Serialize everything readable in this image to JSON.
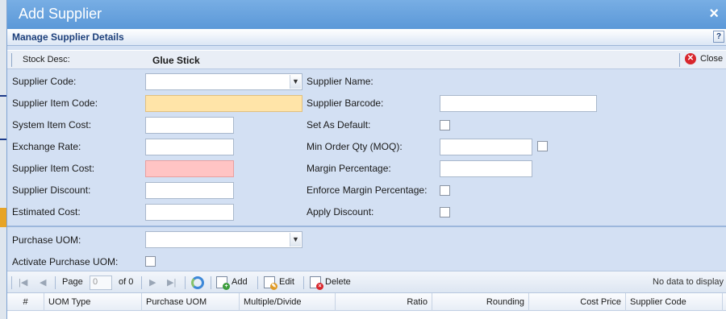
{
  "dialog": {
    "title": "Add Supplier",
    "close_icon": "×"
  },
  "panel": {
    "title": "Manage Supplier Details",
    "help": "?"
  },
  "stock": {
    "label": "Stock Desc:",
    "value": "Glue Stick",
    "close_label": "Close",
    "close_icon": "✕"
  },
  "left_fields": {
    "supplier_code": "Supplier Code:",
    "supplier_item_code": "Supplier Item Code:",
    "system_item_cost": "System Item Cost:",
    "exchange_rate": "Exchange Rate:",
    "supplier_item_cost": "Supplier Item Cost:",
    "supplier_discount": "Supplier Discount:",
    "estimated_cost": "Estimated Cost:"
  },
  "right_fields": {
    "supplier_name": "Supplier Name:",
    "supplier_barcode": "Supplier Barcode:",
    "set_as_default": "Set As Default:",
    "moq": "Min Order Qty (MOQ):",
    "margin_percentage": "Margin Percentage:",
    "enforce_margin": "Enforce Margin Percentage:",
    "apply_discount": "Apply Discount:"
  },
  "uom": {
    "purchase_uom": "Purchase UOM:",
    "activate_purchase_uom": "Activate Purchase UOM:"
  },
  "toolbar": {
    "page_label": "Page",
    "page_value": "0",
    "of_label": "of 0",
    "add": "Add",
    "edit": "Edit",
    "delete": "Delete",
    "status": "No data to display",
    "first": "|◀",
    "prev": "◀",
    "next": "▶",
    "last": "▶|"
  },
  "grid": {
    "columns": [
      "#",
      "UOM Type",
      "Purchase UOM",
      "Multiple/Divide",
      "Ratio",
      "Rounding",
      "Cost Price",
      "Supplier Code"
    ]
  },
  "colors": {
    "title_bar": "#5b98d8",
    "required_field": "#ffe4a8",
    "error_field": "#ffc4c4",
    "close_icon": "#d8262c"
  }
}
